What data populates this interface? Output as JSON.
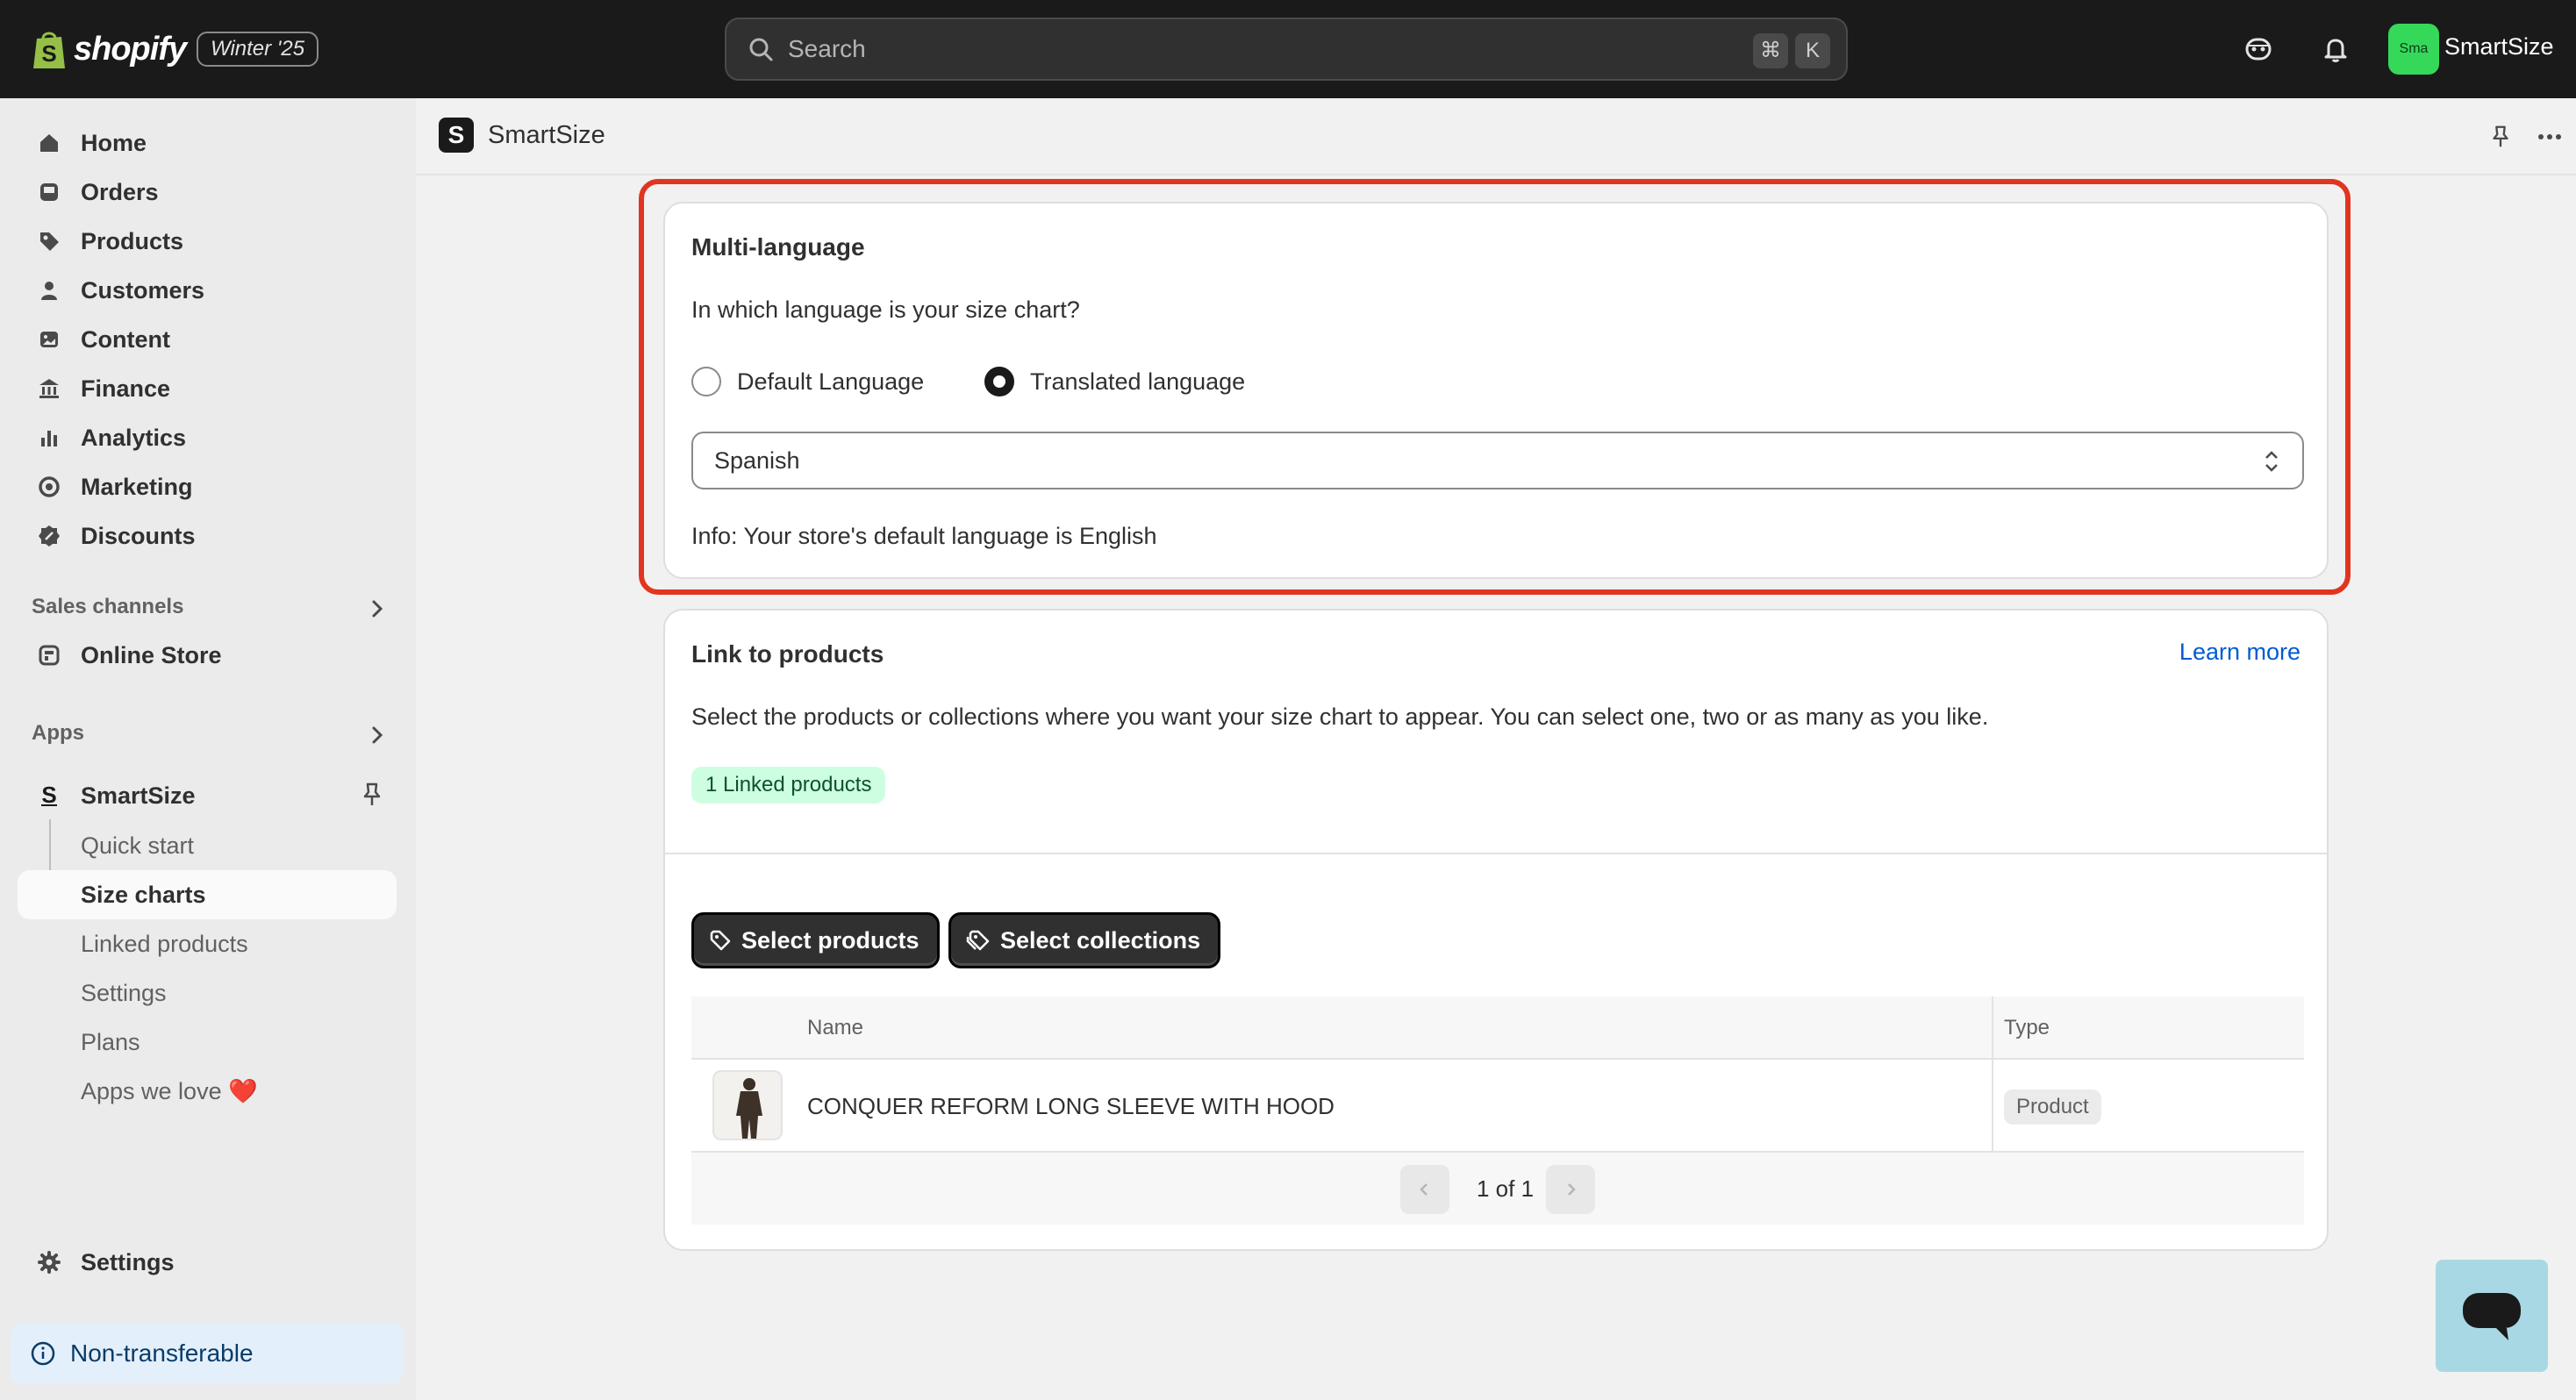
{
  "topbar": {
    "brand": "shopify",
    "edition": "Winter '25",
    "search_placeholder": "Search",
    "shortcut_keys": [
      "⌘",
      "K"
    ],
    "avatar_initials": "Sma",
    "store_name": "SmartSize"
  },
  "sidebar": {
    "items": [
      {
        "label": "Home",
        "icon": "home-icon"
      },
      {
        "label": "Orders",
        "icon": "inbox-icon"
      },
      {
        "label": "Products",
        "icon": "tag-icon"
      },
      {
        "label": "Customers",
        "icon": "person-icon"
      },
      {
        "label": "Content",
        "icon": "image-icon"
      },
      {
        "label": "Finance",
        "icon": "bank-icon"
      },
      {
        "label": "Analytics",
        "icon": "bar-chart-icon"
      },
      {
        "label": "Marketing",
        "icon": "target-icon"
      },
      {
        "label": "Discounts",
        "icon": "discount-icon"
      }
    ],
    "sales_channels_heading": "Sales channels",
    "online_store": "Online Store",
    "apps_heading": "Apps",
    "app_name": "SmartSize",
    "app_subitems": [
      "Quick start",
      "Size charts",
      "Linked products",
      "Settings",
      "Plans",
      "Apps we love ❤️"
    ],
    "active_subitem": "Size charts",
    "settings": "Settings",
    "non_transferable": "Non-transferable"
  },
  "app_header": {
    "logo_letter": "S",
    "title": "SmartSize"
  },
  "multi_language": {
    "title": "Multi-language",
    "question": "In which language is your size chart?",
    "options": [
      "Default Language",
      "Translated language"
    ],
    "selected_option": "Translated language",
    "language_value": "Spanish",
    "info": "Info: Your store's default language is English"
  },
  "link_products": {
    "title": "Link to products",
    "learn_more": "Learn more",
    "description": "Select the products or collections where you want your size chart to appear. You can select one, two or as many as you like.",
    "linked_badge": "1 Linked products",
    "select_products": "Select products",
    "select_collections": "Select collections",
    "table": {
      "headers": [
        "Name",
        "Type"
      ],
      "rows": [
        {
          "name": "CONQUER REFORM LONG SLEEVE WITH HOOD",
          "type": "Product"
        }
      ]
    },
    "pagination": "1 of 1"
  },
  "colors": {
    "topbar": "#1a1a1a",
    "highlight": "#e0351f",
    "link": "#005bd3",
    "success_badge": "#cdfee1",
    "avatar": "#36d85a"
  }
}
